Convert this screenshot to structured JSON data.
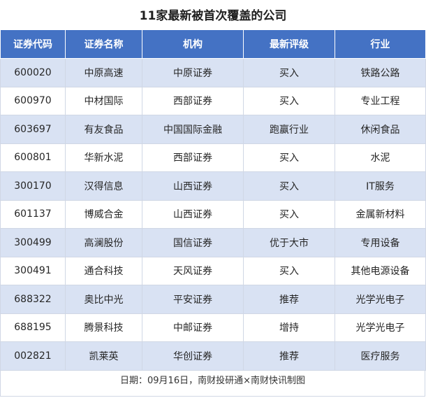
{
  "title": "11家最新被首次覆盖的公司",
  "headers": [
    "证券代码",
    "证券名称",
    "机构",
    "最新评级",
    "行业"
  ],
  "rows": [
    [
      "600020",
      "中原高速",
      "中原证券",
      "买入",
      "铁路公路"
    ],
    [
      "600970",
      "中材国际",
      "西部证券",
      "买入",
      "专业工程"
    ],
    [
      "603697",
      "有友食品",
      "中国国际金融",
      "跑赢行业",
      "休闲食品"
    ],
    [
      "600801",
      "华新水泥",
      "西部证券",
      "买入",
      "水泥"
    ],
    [
      "300170",
      "汉得信息",
      "山西证券",
      "买入",
      "IT服务"
    ],
    [
      "601137",
      "博威合金",
      "山西证券",
      "买入",
      "金属新材料"
    ],
    [
      "300499",
      "高澜股份",
      "国信证券",
      "优于大市",
      "专用设备"
    ],
    [
      "300491",
      "通合科技",
      "天风证券",
      "买入",
      "其他电源设备"
    ],
    [
      "688322",
      "奥比中光",
      "平安证券",
      "推荐",
      "光学光电子"
    ],
    [
      "688195",
      "腾景科技",
      "中邮证券",
      "增持",
      "光学光电子"
    ],
    [
      "002821",
      "凯莱英",
      "华创证券",
      "推荐",
      "医疗服务"
    ]
  ],
  "footer": "日期：09月16日，南财投研通×南财快讯制图",
  "colors": {
    "header_bg": "#4472c4",
    "stripe": "#d9e2f3"
  }
}
